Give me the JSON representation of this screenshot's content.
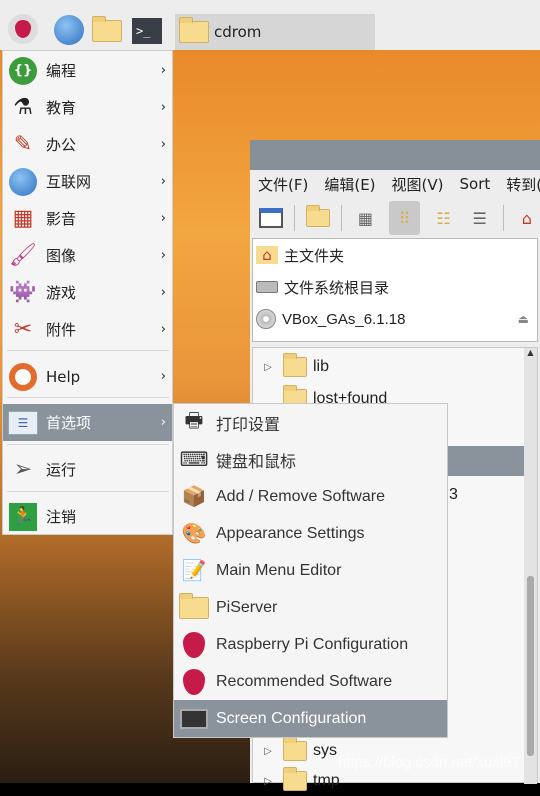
{
  "taskbar": {
    "task_label": "cdrom",
    "icons": [
      "raspberry-menu-icon",
      "globe-icon",
      "folder-icon",
      "terminal-icon"
    ]
  },
  "menu": {
    "items": [
      {
        "label": "编程",
        "icon": "programming-icon"
      },
      {
        "label": "教育",
        "icon": "education-icon"
      },
      {
        "label": "办公",
        "icon": "office-icon"
      },
      {
        "label": "互联网",
        "icon": "internet-icon"
      },
      {
        "label": "影音",
        "icon": "sound-video-icon"
      },
      {
        "label": "图像",
        "icon": "graphics-icon"
      },
      {
        "label": "游戏",
        "icon": "games-icon"
      },
      {
        "label": "附件",
        "icon": "accessories-icon"
      },
      {
        "label": "Help",
        "icon": "help-icon"
      },
      {
        "label": "首选项",
        "icon": "preferences-icon"
      },
      {
        "label": "运行",
        "icon": "run-icon"
      },
      {
        "label": "注销",
        "icon": "logout-icon"
      }
    ]
  },
  "submenu": {
    "items": [
      {
        "label": "打印设置",
        "icon": "printer-icon"
      },
      {
        "label": "键盘和鼠标",
        "icon": "keyboard-mouse-icon"
      },
      {
        "label": "Add / Remove Software",
        "icon": "package-icon"
      },
      {
        "label": "Appearance Settings",
        "icon": "appearance-icon"
      },
      {
        "label": "Main Menu Editor",
        "icon": "menu-editor-icon"
      },
      {
        "label": "PiServer",
        "icon": "piserver-icon"
      },
      {
        "label": "Raspberry Pi Configuration",
        "icon": "raspberry-icon"
      },
      {
        "label": "Recommended Software",
        "icon": "raspberry-icon"
      },
      {
        "label": "Screen Configuration",
        "icon": "monitor-icon"
      }
    ],
    "selected": "Screen Configuration"
  },
  "file_manager": {
    "menubar": [
      "文件(F)",
      "编辑(E)",
      "视图(V)",
      "Sort",
      "转到(G"
    ],
    "places": [
      "主文件夹",
      "文件系统根目录",
      "VBox_GAs_6.1.18"
    ],
    "tree": [
      {
        "name": "lib",
        "expandable": true
      },
      {
        "name": "lost+found",
        "expandable": false
      },
      {
        "name": "sys",
        "expandable": true
      },
      {
        "name": "tmp",
        "expandable": true
      }
    ],
    "partial_text": "3"
  },
  "watermark": "https://blog.csdn.net/xuxl97",
  "colors": {
    "selection": "#8a939c",
    "titlebar": "#878f99",
    "folder": "#f7dc8f"
  }
}
